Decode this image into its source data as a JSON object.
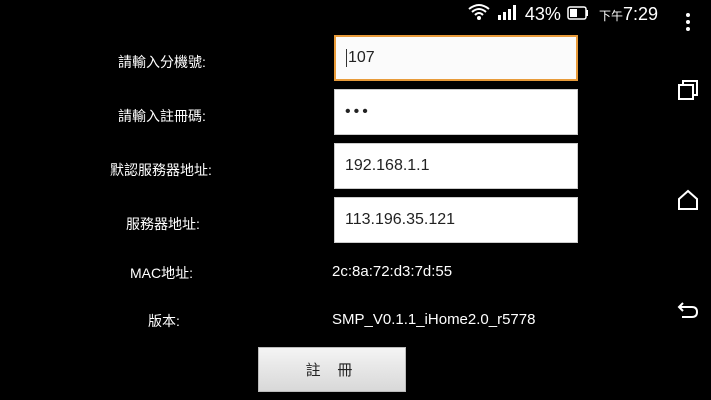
{
  "status_bar": {
    "battery_percent": "43%",
    "ampm": "下午",
    "time": "7:29",
    "icons": [
      "wifi-icon",
      "signal-icon",
      "battery-icon"
    ]
  },
  "form": {
    "extension_label": "請輸入分機號:",
    "extension_value": "107",
    "register_code_label": "請輸入註冊碼:",
    "register_code_value": "•••",
    "default_server_label": "默認服務器地址:",
    "default_server_value": "192.168.1.1",
    "server_label": "服務器地址:",
    "server_value": "113.196.35.121",
    "mac_label": "MAC地址:",
    "mac_value": "2c:8a:72:d3:7d:55",
    "version_label": "版本:",
    "version_value": "SMP_V0.1.1_iHome2.0_r5778",
    "register_button": "註 冊"
  },
  "nav": [
    "more-icon",
    "recent-apps-icon",
    "home-icon",
    "back-icon"
  ],
  "colors": {
    "focus_border": "#e89b3a",
    "background": "#000000"
  }
}
